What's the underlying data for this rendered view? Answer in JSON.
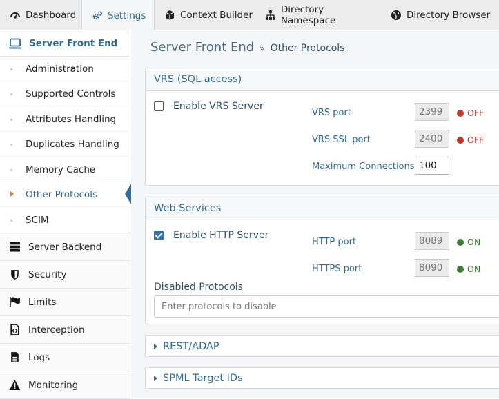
{
  "tabs": [
    {
      "label": "Dashboard",
      "icon": "dashboard-icon"
    },
    {
      "label": "Settings",
      "icon": "gears-icon",
      "active": true
    },
    {
      "label": "Context Builder",
      "icon": "cube-icon"
    },
    {
      "label": "Directory Namespace",
      "icon": "sitemap-icon"
    },
    {
      "label": "Directory Browser",
      "icon": "globe-icon"
    }
  ],
  "sidebar": {
    "header": {
      "label": "Server Front End",
      "icon": "laptop-icon"
    },
    "sub_items": [
      {
        "label": "Administration"
      },
      {
        "label": "Supported Controls"
      },
      {
        "label": "Attributes Handling"
      },
      {
        "label": "Duplicates Handling"
      },
      {
        "label": "Memory Cache"
      },
      {
        "label": "Other Protocols",
        "active": true
      },
      {
        "label": "SCIM"
      }
    ],
    "main_items": [
      {
        "label": "Server Backend",
        "icon": "server-icon"
      },
      {
        "label": "Security",
        "icon": "shield-icon"
      },
      {
        "label": "Limits",
        "icon": "flag-icon"
      },
      {
        "label": "Interception",
        "icon": "code-file-icon"
      },
      {
        "label": "Logs",
        "icon": "document-icon"
      },
      {
        "label": "Monitoring",
        "icon": "warning-icon"
      }
    ]
  },
  "breadcrumb": {
    "section": "Server Front End",
    "separator": "»",
    "page": "Other Protocols"
  },
  "vrs": {
    "title": "VRS (SQL access)",
    "enable_label": "Enable VRS Server",
    "enabled": false,
    "fields": [
      {
        "label": "VRS port",
        "value": "2399",
        "status": "OFF",
        "status_color": "#c0392b"
      },
      {
        "label": "VRS SSL port",
        "value": "2400",
        "status": "OFF",
        "status_color": "#c0392b"
      },
      {
        "label": "Maximum Connections",
        "value": "100"
      }
    ]
  },
  "web": {
    "title": "Web Services",
    "enable_label": "Enable HTTP Server",
    "enabled": true,
    "fields": [
      {
        "label": "HTTP port",
        "value": "8089",
        "status": "ON",
        "status_color": "#3a7d2c"
      },
      {
        "label": "HTTPS port",
        "value": "8090",
        "status": "ON",
        "status_color": "#3a7d2c"
      }
    ],
    "disabled_protocols_label": "Disabled Protocols",
    "disabled_protocols_placeholder": "Enter protocols to disable"
  },
  "collapsed_sections": [
    {
      "label": "REST/ADAP"
    },
    {
      "label": "SPML Target IDs"
    }
  ],
  "colors": {
    "accent": "#2f6b9a",
    "off": "#c0392b",
    "on": "#3a7d2c",
    "active_caret": "#e3722c"
  }
}
